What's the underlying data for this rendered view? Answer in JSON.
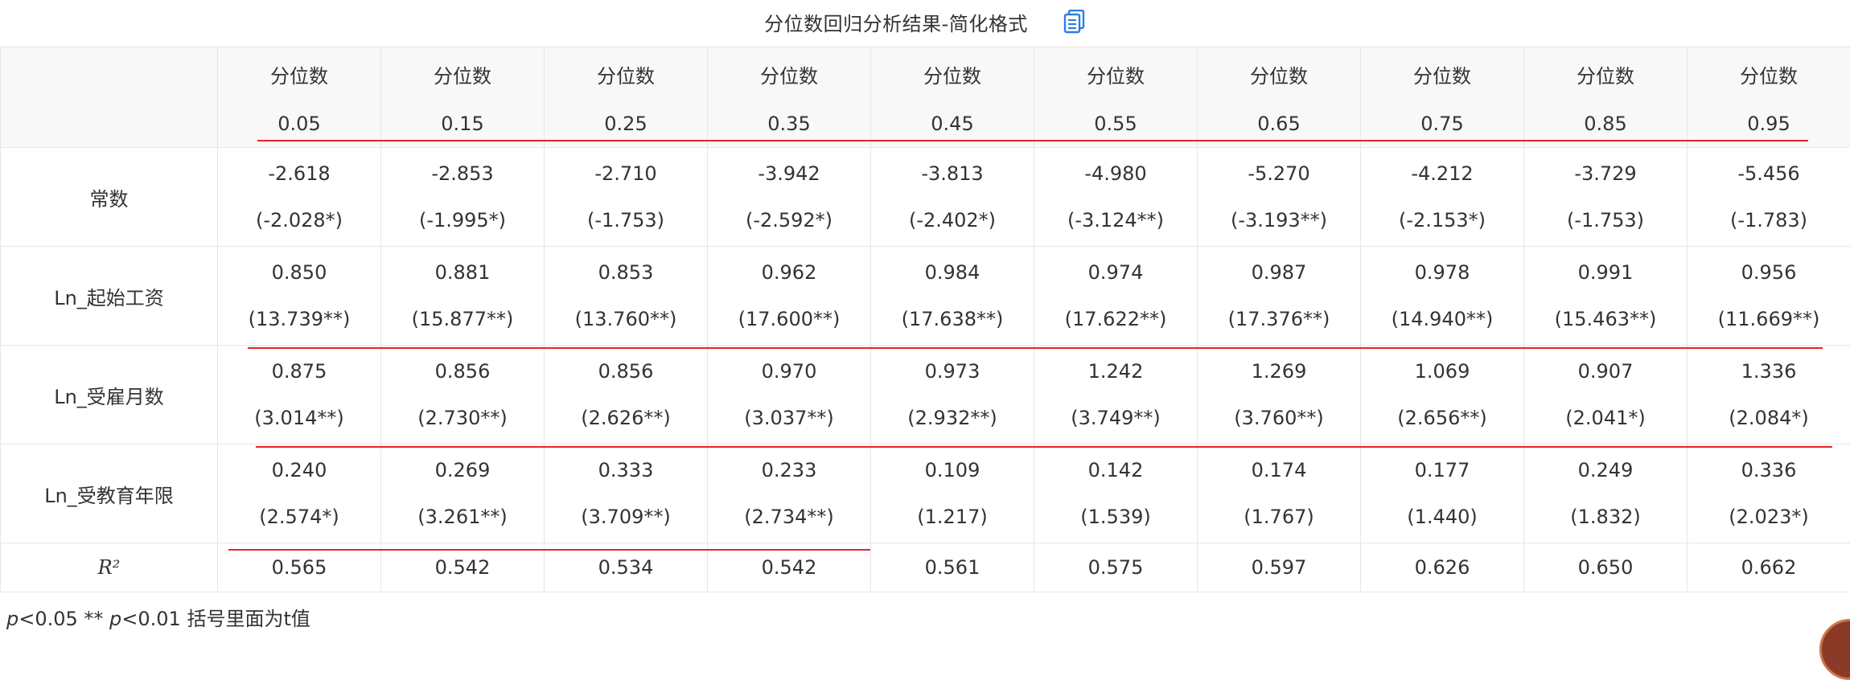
{
  "title": "分位数回归分析结果-简化格式",
  "header": {
    "top_label": "分位数",
    "quantiles": [
      "0.05",
      "0.15",
      "0.25",
      "0.35",
      "0.45",
      "0.55",
      "0.65",
      "0.75",
      "0.85",
      "0.95"
    ]
  },
  "rows": [
    {
      "label": "常数",
      "coef": [
        "-2.618",
        "-2.853",
        "-2.710",
        "-3.942",
        "-3.813",
        "-4.980",
        "-5.270",
        "-4.212",
        "-3.729",
        "-5.456"
      ],
      "t": [
        "(-2.028*)",
        "(-1.995*)",
        "(-1.753)",
        "(-2.592*)",
        "(-2.402*)",
        "(-3.124**)",
        "(-3.193**)",
        "(-2.153*)",
        "(-1.753)",
        "(-1.783)"
      ]
    },
    {
      "label": "Ln_起始工资",
      "coef": [
        "0.850",
        "0.881",
        "0.853",
        "0.962",
        "0.984",
        "0.974",
        "0.987",
        "0.978",
        "0.991",
        "0.956"
      ],
      "t": [
        "(13.739**)",
        "(15.877**)",
        "(13.760**)",
        "(17.600**)",
        "(17.638**)",
        "(17.622**)",
        "(17.376**)",
        "(14.940**)",
        "(15.463**)",
        "(11.669**)"
      ]
    },
    {
      "label": "Ln_受雇月数",
      "coef": [
        "0.875",
        "0.856",
        "0.856",
        "0.970",
        "0.973",
        "1.242",
        "1.269",
        "1.069",
        "0.907",
        "1.336"
      ],
      "t": [
        "(3.014**)",
        "(2.730**)",
        "(2.626**)",
        "(3.037**)",
        "(2.932**)",
        "(3.749**)",
        "(3.760**)",
        "(2.656**)",
        "(2.041*)",
        "(2.084*)"
      ]
    },
    {
      "label": "Ln_受教育年限",
      "coef": [
        "0.240",
        "0.269",
        "0.333",
        "0.233",
        "0.109",
        "0.142",
        "0.174",
        "0.177",
        "0.249",
        "0.336"
      ],
      "t": [
        "(2.574*)",
        "(3.261**)",
        "(3.709**)",
        "(2.734**)",
        "(1.217)",
        "(1.539)",
        "(1.767)",
        "(1.440)",
        "(1.832)",
        "(2.023*)"
      ]
    }
  ],
  "r2": {
    "label": "R²",
    "values": [
      "0.565",
      "0.542",
      "0.534",
      "0.542",
      "0.561",
      "0.575",
      "0.597",
      "0.626",
      "0.650",
      "0.662"
    ]
  },
  "note": {
    "p1": "p",
    "t1": "<0.05 ** ",
    "p2": "p",
    "t2": "<0.01 括号里面为t值"
  },
  "colors": {
    "annotation_line": "#e8232b",
    "icon": "#2f7de1",
    "header_bg": "#f8f8f8",
    "border": "#e6e6e6"
  },
  "icons": {
    "copy": "copy-document-icon"
  }
}
